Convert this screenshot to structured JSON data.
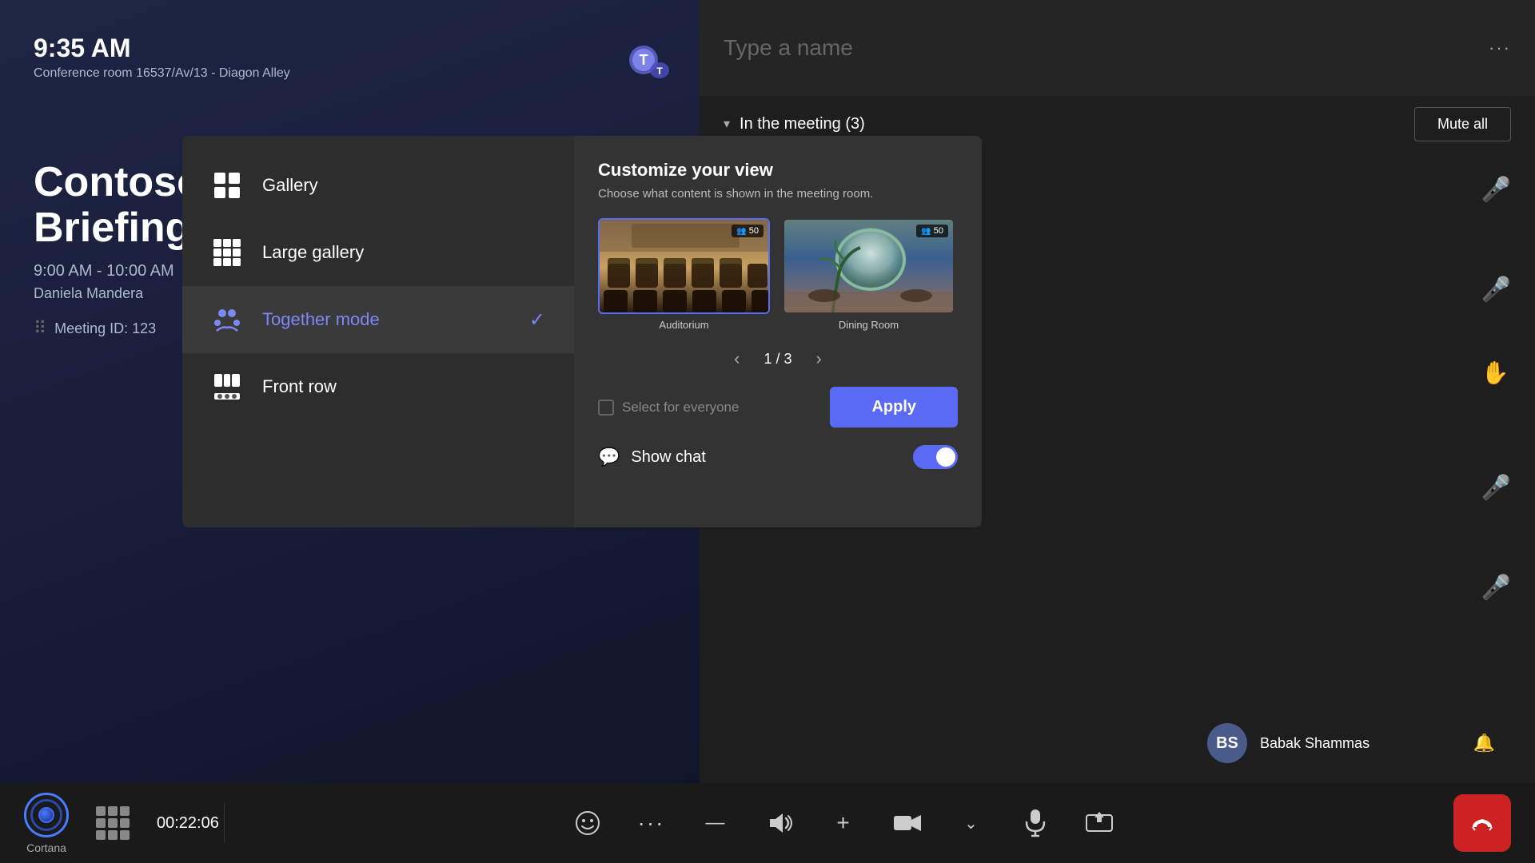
{
  "time": {
    "current": "9:35 AM",
    "room": "Conference room 16537/Av/13 - Diagon Alley"
  },
  "meeting": {
    "name_line1": "Contoso W",
    "name_line2": "Briefing",
    "time_range": "9:00 AM - 10:00 AM",
    "organizer": "Daniela Mandera",
    "id_label": "Meeting ID: 123"
  },
  "search": {
    "placeholder": "Type a name"
  },
  "participants_header": {
    "label": "In the meeting (3)",
    "mute_all": "Mute all"
  },
  "menu": {
    "items": [
      {
        "id": "gallery",
        "label": "Gallery",
        "active": false
      },
      {
        "id": "large-gallery",
        "label": "Large gallery",
        "active": false
      },
      {
        "id": "together-mode",
        "label": "Together mode",
        "active": true
      },
      {
        "id": "front-row",
        "label": "Front row",
        "active": false
      }
    ]
  },
  "customize": {
    "title": "Customize your view",
    "subtitle": "Choose what content is shown in the meeting room.",
    "scenes": [
      {
        "id": "auditorium",
        "label": "Auditorium",
        "badge": "50",
        "selected": true
      },
      {
        "id": "dining-room",
        "label": "Dining Room",
        "badge": "50",
        "selected": false
      }
    ],
    "pagination": {
      "current": "1",
      "total": "3",
      "display": "1 / 3"
    },
    "select_everyone_label": "Select for everyone",
    "apply_label": "Apply",
    "show_chat_label": "Show chat",
    "show_chat_on": true
  },
  "toolbar": {
    "timer": "00:22:06",
    "cortana_label": "Cortana",
    "buttons": [
      {
        "id": "reactions",
        "icon": "🙂",
        "label": "Reactions"
      },
      {
        "id": "more",
        "icon": "···",
        "label": "More"
      },
      {
        "id": "minimize",
        "icon": "—",
        "label": "Minimize"
      },
      {
        "id": "volume",
        "icon": "🔊",
        "label": "Volume"
      },
      {
        "id": "add",
        "icon": "+",
        "label": "Add"
      },
      {
        "id": "camera",
        "icon": "📷",
        "label": "Camera"
      },
      {
        "id": "more2",
        "icon": "⌄",
        "label": "More camera"
      },
      {
        "id": "mic",
        "icon": "🎤",
        "label": "Microphone"
      },
      {
        "id": "share",
        "icon": "⬆",
        "label": "Share"
      },
      {
        "id": "end",
        "icon": "✆",
        "label": "End call"
      }
    ]
  },
  "participant": {
    "name": "Babak Shammas",
    "initials": "BS"
  }
}
